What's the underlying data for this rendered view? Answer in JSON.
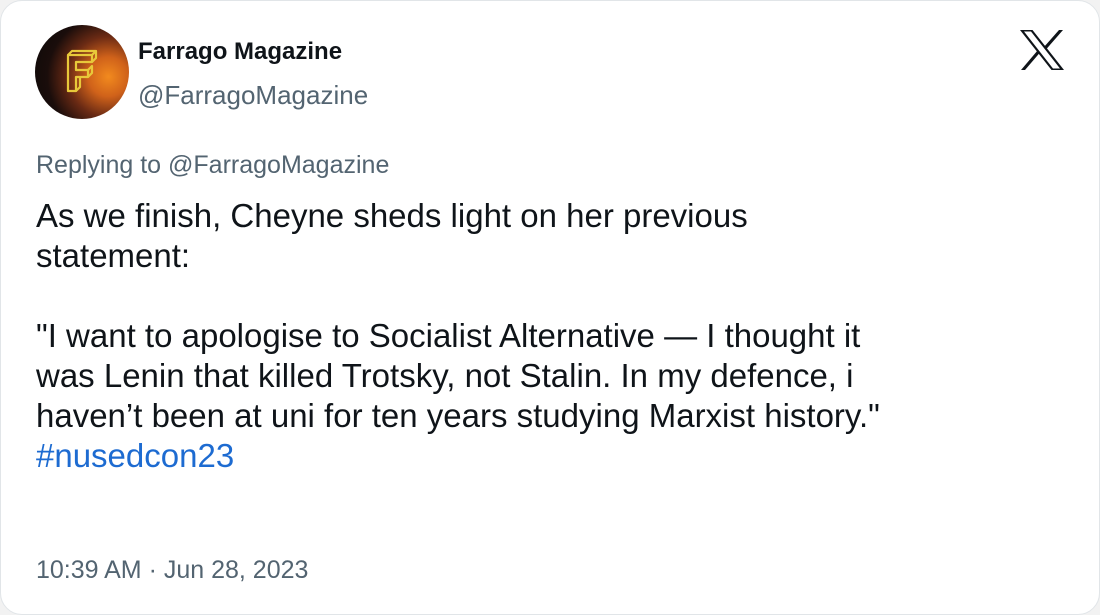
{
  "author": {
    "name": "Farrago Magazine",
    "handle": "@FarragoMagazine",
    "avatar_letter": "F",
    "avatar_icon": "farrago-f-logo-icon"
  },
  "platform_icon": "x-logo-icon",
  "reply": {
    "prefix": "Replying to ",
    "mention": "@FarragoMagazine"
  },
  "tweet": {
    "line1": "As we finish, Cheyne sheds light on her previous",
    "line2": "statement:",
    "line3": "\"I want to apologise to Socialist Alternative — I thought it",
    "line4": "was Lenin that killed Trotsky, not Stalin. In my defence, i",
    "line5": "haven’t been at uni for ten years studying Marxist history.\"",
    "hashtag": "#nusedcon23"
  },
  "timestamp": "10:39 AM · Jun 28, 2023",
  "colors": {
    "text": "#0f1419",
    "muted": "#536471",
    "link": "#1d6bd1",
    "avatar_glow": "#f28a1e"
  }
}
